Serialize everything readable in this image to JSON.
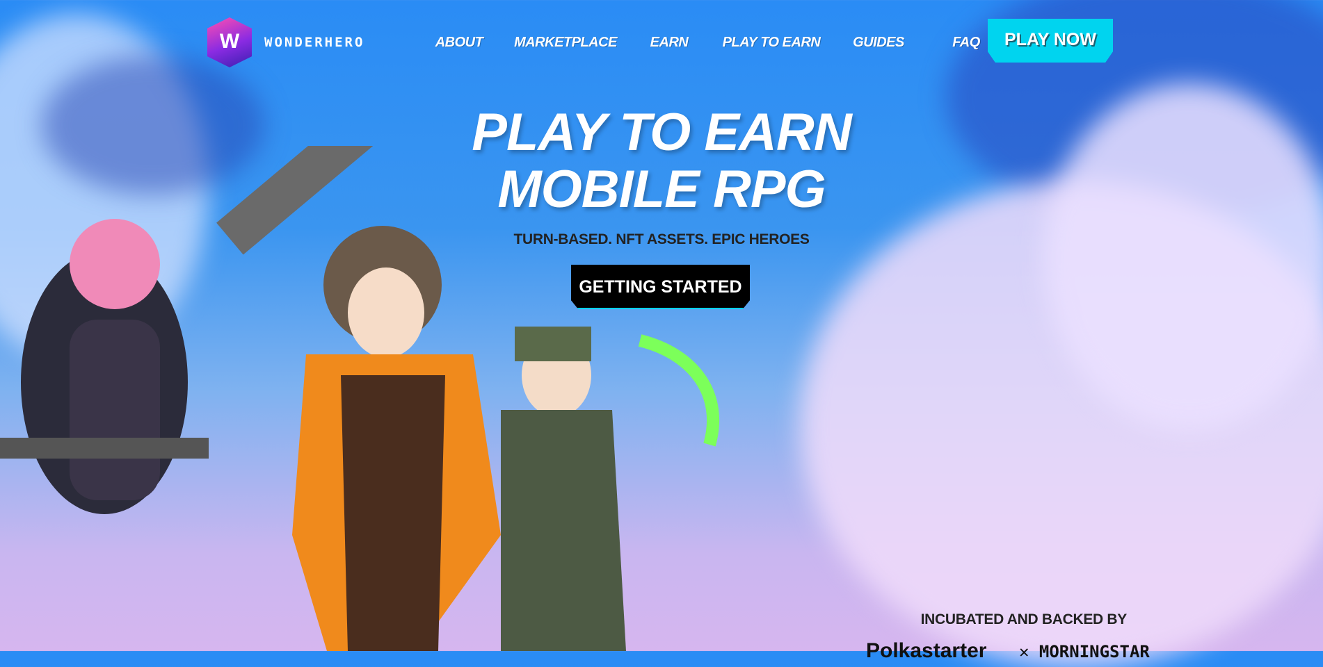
{
  "brand": {
    "name": "WONDERHERO",
    "logo_letter": "W"
  },
  "nav": {
    "items": [
      "ABOUT",
      "MARKETPLACE",
      "EARN",
      "PLAY TO EARN",
      "GUIDES",
      "FAQ"
    ],
    "cta": "PLAY NOW"
  },
  "hero": {
    "title_line1": "PLAY TO EARN",
    "title_line2": "MOBILE RPG",
    "subtitle": "TURN-BASED. NFT ASSETS. EPIC HEROES",
    "button": "GETTING STARTED"
  },
  "backers": {
    "heading": "INCUBATED AND BACKED BY",
    "partners": [
      "Polkastarter",
      "MORNINGSTAR"
    ]
  },
  "colors": {
    "accent": "#00d4ef",
    "sky": "#2a8cf5"
  }
}
